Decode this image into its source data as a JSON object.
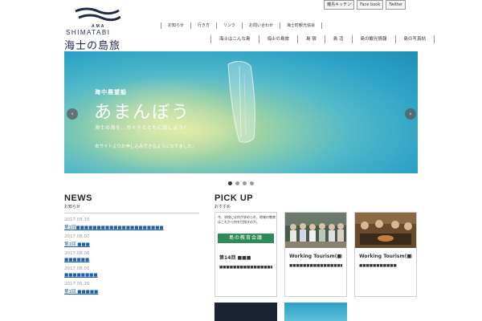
{
  "brand": {
    "ama": "AMA",
    "shimatabi": "SHIMATABI",
    "title": "海士の島旅"
  },
  "social": [
    "離島キッチン",
    "Face book",
    "Twitter"
  ],
  "subnav": [
    "お知らせ",
    "行き方",
    "リンク",
    "お問い合わせ",
    "海士町観光協会"
  ],
  "mainnav": [
    "海士はこんな島",
    "海士の島旅",
    "島 宿",
    "島 活",
    "島の観光情報",
    "島の写真帖"
  ],
  "hero": {
    "kicker": "海中展望船",
    "title": "あまんぼう",
    "subtitle": "海士の海を、ガイドとともに旅しよう！",
    "note": "本サイトよりお申し込みできるようになりました。",
    "prev": "‹",
    "next": "›"
  },
  "slider": {
    "count": 4,
    "active": 0
  },
  "news": {
    "title": "NEWS",
    "subtitle": "お知らせ",
    "items": [
      {
        "date": "2017.09.15",
        "text": "第1回■■■■■■■■■■■■■■■■■■■■■"
      },
      {
        "date": "2017.08.07",
        "text": "第1回 ■■■"
      },
      {
        "date": "2017.08.06",
        "text": "■■■■■■"
      },
      {
        "date": "2017.08.01",
        "text": "■■■■■■■■"
      },
      {
        "date": "2017.06.20",
        "text": "第1回 ■■■■■"
      }
    ]
  },
  "pickup": {
    "title": "PICK UP",
    "subtitle": "おすすめ",
    "cards": [
      {
        "image_text": "今、学校には何が求められ、地域の教育はこれから何を目指すのか。",
        "banner": "島の教育会議",
        "title": "第14回 ■■■",
        "desc": "■■■■■■■■■■■■■■■■"
      },
      {
        "title": "Working Tourism(■■",
        "desc": "■■■■■■■■■■■■■■■■■■■■■■■"
      },
      {
        "title": "Working Tourism(■■",
        "desc": "■■■■■■■■■■■"
      }
    ]
  },
  "colors": {
    "link": "#1a5fa8",
    "edu_banner": "#2e8b57",
    "logo": "#1f2a44"
  }
}
